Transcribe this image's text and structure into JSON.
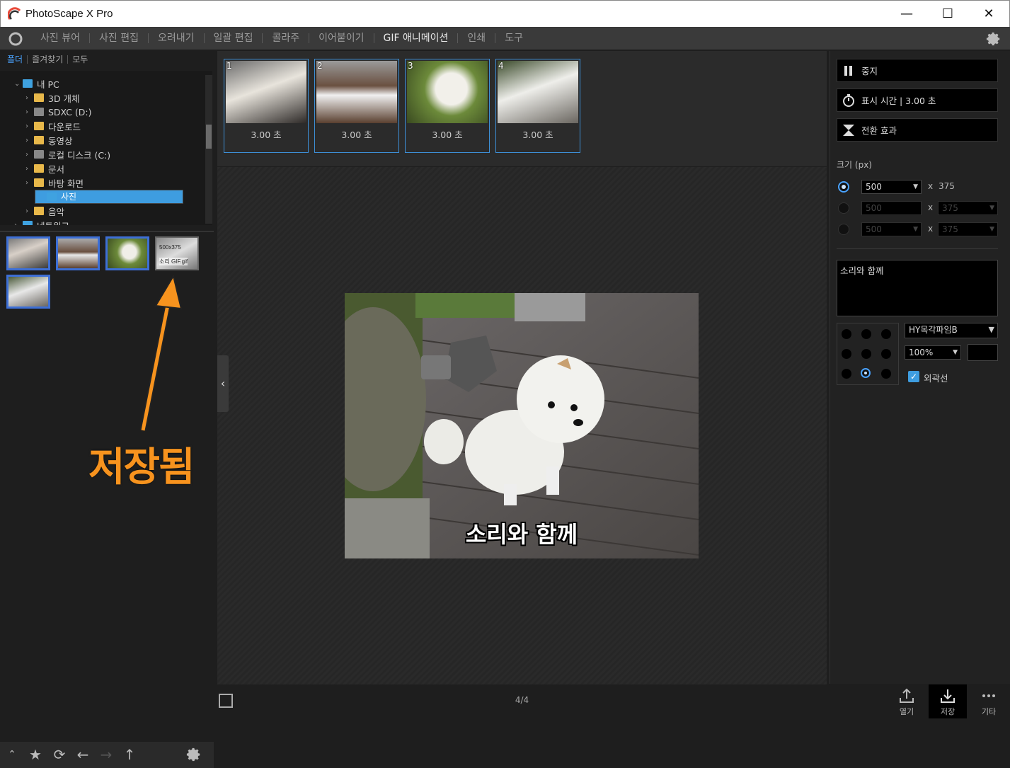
{
  "window": {
    "title": "PhotoScape X Pro",
    "minimize": "—",
    "maximize": "☐",
    "close": "✕"
  },
  "menu": {
    "items": [
      {
        "label": "사진 뷰어"
      },
      {
        "label": "사진 편집"
      },
      {
        "label": "오려내기"
      },
      {
        "label": "일괄 편집"
      },
      {
        "label": "콜라주"
      },
      {
        "label": "이어붙이기"
      },
      {
        "label": "GIF 애니메이션",
        "active": true
      },
      {
        "label": "인쇄"
      },
      {
        "label": "도구"
      }
    ]
  },
  "sidebar": {
    "tabs": [
      "폴더",
      "즐겨찾기",
      "모두"
    ],
    "tree": [
      {
        "label": "내 PC",
        "arrow": "⌄"
      },
      {
        "label": "3D 개체",
        "arrow": "›"
      },
      {
        "label": "SDXC (D:)",
        "arrow": "›"
      },
      {
        "label": "다운로드",
        "arrow": "›"
      },
      {
        "label": "동영상",
        "arrow": "›"
      },
      {
        "label": "로컬 디스크 (C:)",
        "arrow": "›"
      },
      {
        "label": "문서",
        "arrow": "›"
      },
      {
        "label": "바탕 화면",
        "arrow": "›"
      },
      {
        "label": "사진",
        "arrow": ""
      },
      {
        "label": "음악",
        "arrow": "›"
      },
      {
        "label": "네트워크",
        "arrow": "›"
      }
    ],
    "gif_thumb": {
      "size": "500x375",
      "name": "소리 GIF.gif"
    },
    "annotation": "저장됨"
  },
  "frames": [
    {
      "num": "1",
      "duration": "3.00 초"
    },
    {
      "num": "2",
      "duration": "3.00 초"
    },
    {
      "num": "3",
      "duration": "3.00 초"
    },
    {
      "num": "4",
      "duration": "3.00 초"
    }
  ],
  "preview": {
    "caption": "소리와 함께",
    "page": "4/4"
  },
  "right": {
    "stop": "중지",
    "display_time": "표시 시간 | 3.00 초",
    "transition": "전환 효과",
    "size_label": "크기 (px)",
    "size_rows": [
      {
        "w": "500",
        "h": "375",
        "x": "x"
      },
      {
        "w": "500",
        "h": "375",
        "x": "x"
      },
      {
        "w": "500",
        "h": "375",
        "x": "x"
      }
    ],
    "text": "소리와 함께",
    "font": "HY목각파임B",
    "scale": "100%",
    "outline": "외곽선"
  },
  "bottom_right": {
    "open": "열기",
    "save": "저장",
    "more": "기타"
  },
  "colors": {
    "accent": "#3e9de0",
    "annotation": "#f7931e"
  }
}
